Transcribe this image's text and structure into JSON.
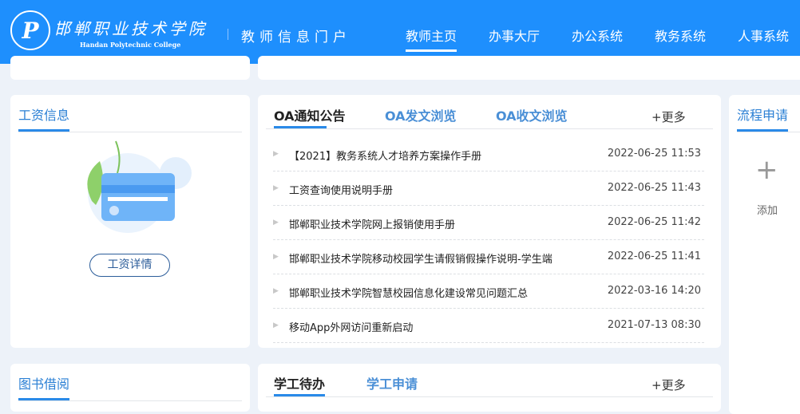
{
  "header": {
    "school_cn": "邯郸职业技术学院",
    "school_en": "Handan Polytechnic College",
    "portal": "教师信息门户",
    "nav": [
      "教师主页",
      "办事大厅",
      "办公系统",
      "教务系统",
      "人事系统"
    ]
  },
  "salary": {
    "title": "工资信息",
    "button": "工资详情"
  },
  "oa": {
    "tabs": [
      "OA通知公告",
      "OA发文浏览",
      "OA收文浏览"
    ],
    "more": "+更多",
    "items": [
      {
        "title": "【2021】教务系统人才培养方案操作手册",
        "date": "2022-06-25 11:53"
      },
      {
        "title": "工资查询使用说明手册",
        "date": "2022-06-25 11:43"
      },
      {
        "title": "邯郸职业技术学院网上报销使用手册",
        "date": "2022-06-25 11:42"
      },
      {
        "title": "邯郸职业技术学院移动校园学生请假销假操作说明-学生端",
        "date": "2022-06-25 11:41"
      },
      {
        "title": "邯郸职业技术学院智慧校园信息化建设常见问题汇总",
        "date": "2022-03-16 14:20"
      },
      {
        "title": "移动App外网访问重新启动",
        "date": "2021-07-13 08:30"
      }
    ]
  },
  "process": {
    "title": "流程申请",
    "add": "添加"
  },
  "library": {
    "title": "图书借阅"
  },
  "student": {
    "tabs": [
      "学工待办",
      "学工申请"
    ],
    "more": "+更多"
  }
}
